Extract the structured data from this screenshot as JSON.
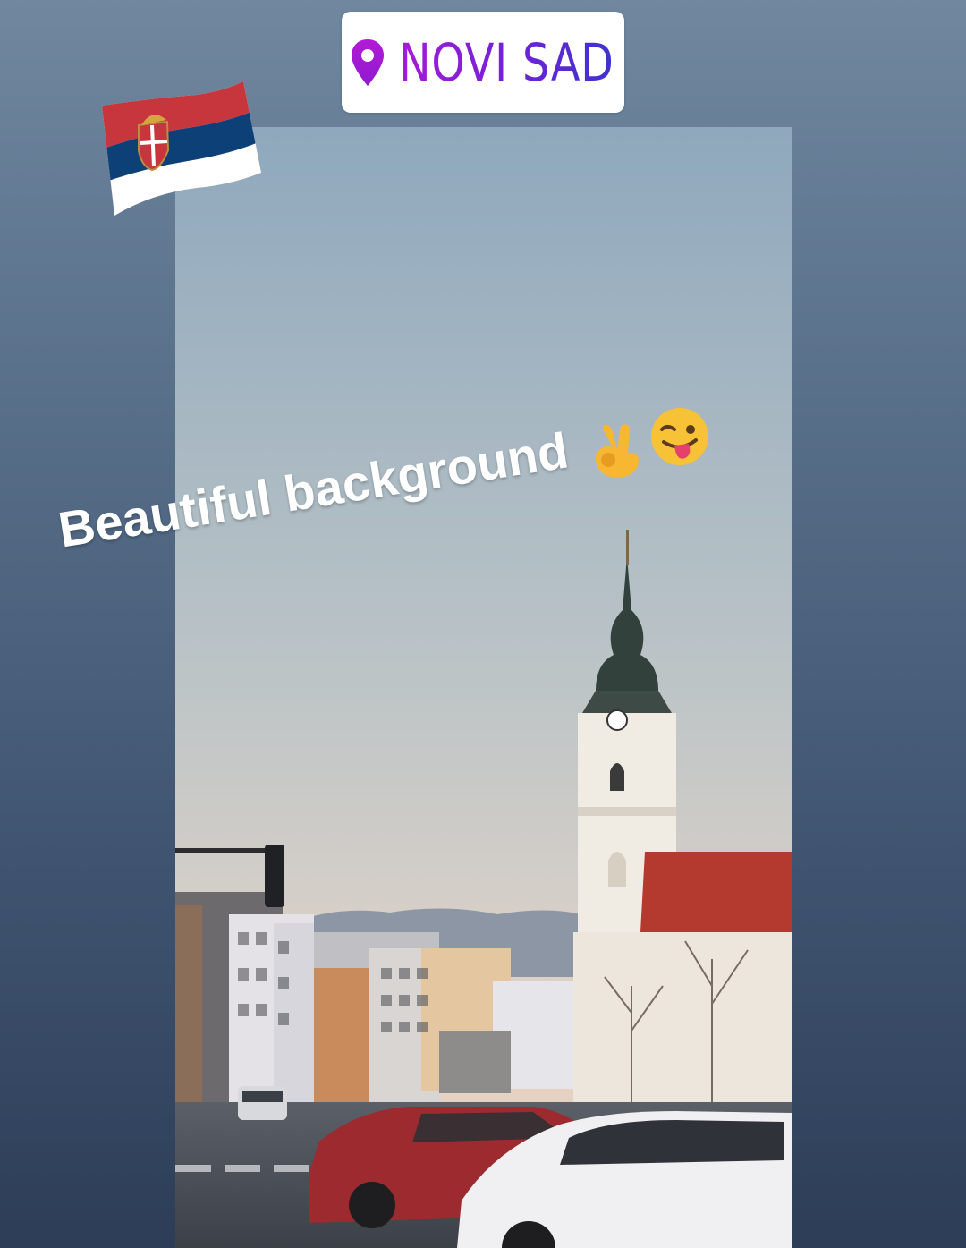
{
  "location_sticker": {
    "text": "NOVI SAD",
    "icon": "location-pin-icon",
    "color_start": "#a51bd8",
    "color_end": "#3d33cf"
  },
  "flag_sticker": {
    "icon": "serbia-flag-icon",
    "colors": [
      "#c6363c",
      "#0c4077",
      "#ffffff"
    ]
  },
  "caption": {
    "text": "Beautiful background"
  },
  "emojis": [
    {
      "icon": "ok-hand-emoji"
    },
    {
      "icon": "winking-face-tongue-emoji"
    }
  ],
  "photo": {
    "subject": "church-tower-street-scene"
  }
}
